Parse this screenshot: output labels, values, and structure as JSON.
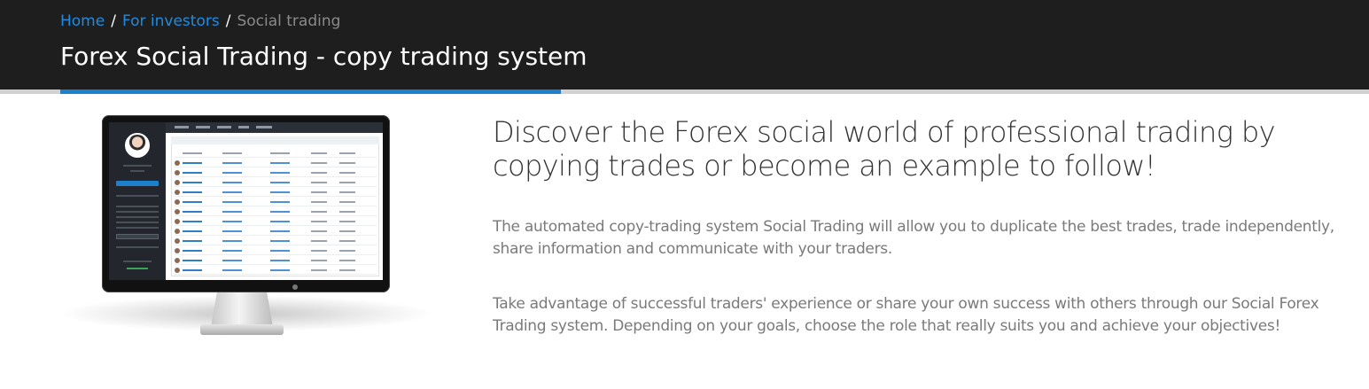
{
  "breadcrumb": {
    "items": [
      {
        "label": "Home",
        "link": true
      },
      {
        "label": "For investors",
        "link": true
      },
      {
        "label": "Social trading",
        "link": false
      }
    ],
    "separator": "/"
  },
  "header": {
    "title": "Forex Social Trading - copy trading system",
    "progress_fraction": 0.41
  },
  "colors": {
    "header_bg": "#1e1e1e",
    "link": "#1e8ce0",
    "accent": "#1e7fcb",
    "body_text": "#7a7a7a",
    "headline_text": "#333333"
  },
  "illustration": {
    "icon": "monitor-with-trading-platform"
  },
  "content": {
    "headline": "Discover the Forex social world of professional trading by copying trades or become an example to follow!",
    "paragraph_1": "The automated copy-trading system Social Trading will allow you to duplicate the best trades, trade independently, share information and communicate with your traders.",
    "paragraph_2": "Take advantage of successful traders' experience or share your own success with others through our Social Forex Trading system. Depending on your goals, choose the role that really suits you and achieve your objectives!"
  }
}
